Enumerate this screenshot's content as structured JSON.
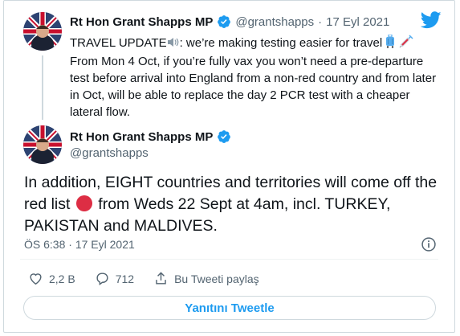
{
  "parent_tweet": {
    "author_name": "Rt Hon Grant Shapps MP",
    "handle": "@grantshapps",
    "separator": "·",
    "date": "17 Eyl 2021",
    "text_part1": "TRAVEL UPDATE",
    "text_part2": ": we’re making testing easier for travel ",
    "text_part3": " From Mon 4 Oct, if you’re fully vax you won’t need a pre-departure test before arrival into England from a non-red country and from later in Oct, will be able to replace the day 2 PCR test with a cheaper lateral flow."
  },
  "main_tweet": {
    "author_name": "Rt Hon Grant Shapps MP",
    "handle": "@grantshapps",
    "text_part1": "In addition, EIGHT countries and territories will come off the red list ",
    "text_part2": " from Weds 22 Sept at 4am, incl. TURKEY, PAKISTAN and MALDIVES.",
    "time": "ÖS 6:38",
    "separator": "·",
    "date": "17 Eyl 2021"
  },
  "actions": {
    "likes": "2,2 B",
    "replies": "712",
    "share_label": "Bu Tweeti paylaş"
  },
  "reply_button_label": "Yanıtını Tweetle",
  "colors": {
    "accent": "#1d9bf0",
    "verified": "#1d9bf0",
    "text": "#0f1419",
    "muted": "#536471",
    "red_dot": "#dd2e44"
  },
  "icons": [
    "twitter-bird-icon",
    "verified-badge-icon",
    "speaker-icon",
    "luggage-icon",
    "syringe-icon",
    "red-circle-icon",
    "info-icon",
    "heart-icon",
    "reply-icon",
    "share-icon"
  ]
}
